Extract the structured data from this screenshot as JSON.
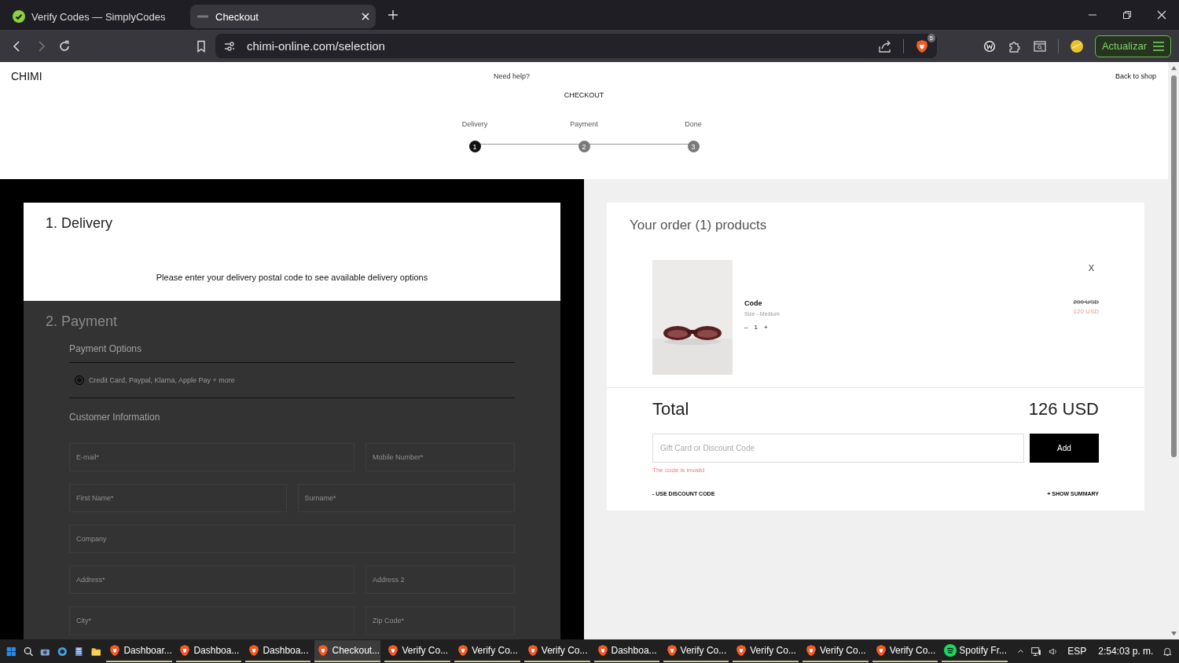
{
  "browser": {
    "tabs": [
      {
        "title": "Verify Codes — SimplyCodes",
        "selected": false
      },
      {
        "title": "Checkout",
        "selected": true
      }
    ],
    "url": "chimi-online.com/selection",
    "shield_badge": "5",
    "update_button": "Actualizar"
  },
  "header": {
    "logo": "CHIMI",
    "help": "Need help?",
    "title": "CHECKOUT",
    "back": "Back to shop"
  },
  "steps": [
    {
      "label": "Delivery",
      "number": "1",
      "selected": true
    },
    {
      "label": "Payment",
      "number": "2",
      "selected": false
    },
    {
      "label": "Done",
      "number": "3",
      "selected": false
    }
  ],
  "delivery": {
    "title": "1. Delivery",
    "message": "Please enter your delivery postal code to see available delivery options"
  },
  "payment": {
    "title": "2. Payment",
    "options_title": "Payment Options",
    "option": {
      "label": "Credit Card, Paypal, Klarna, Apple Pay + more",
      "checked": true
    },
    "customer_title": "Customer Information",
    "rows": [
      {
        "kind": "wide-narrow",
        "fields": [
          {
            "placeholder": "E-mail*"
          },
          {
            "placeholder": "Mobile Number*"
          }
        ]
      },
      {
        "kind": "even",
        "fields": [
          {
            "placeholder": "First Name*"
          },
          {
            "placeholder": "Surname*"
          }
        ]
      },
      {
        "kind": "single",
        "fields": [
          {
            "placeholder": "Company"
          }
        ]
      },
      {
        "kind": "wide-narrow",
        "fields": [
          {
            "placeholder": "Address*"
          },
          {
            "placeholder": "Address 2"
          }
        ]
      },
      {
        "kind": "wide-narrow",
        "fields": [
          {
            "placeholder": "City*"
          },
          {
            "placeholder": "Zip Code*"
          }
        ]
      }
    ]
  },
  "order": {
    "title": "Your order (1) products",
    "item": {
      "kind": "picture",
      "name": "Code",
      "size": "Size - Medium",
      "minus": "–",
      "quantity": "1",
      "plus": "+",
      "old_price": "200 USD",
      "price": "120 USD",
      "remove": "X"
    },
    "total_label": "Total",
    "total": "126 USD",
    "discount_placeholder": "Gift Card or Discount Code",
    "add": "Add",
    "error": "The code is invalid",
    "use_discount": "- USE DISCOUNT CODE",
    "show_summary": "+ SHOW SUMMARY"
  },
  "taskbar": {
    "apps": [
      {
        "label": "Dashboar...",
        "selected": false
      },
      {
        "label": "Dashboa...",
        "selected": false
      },
      {
        "label": "Dashboa...",
        "selected": false
      },
      {
        "label": "Checkout...",
        "selected": true
      },
      {
        "label": "Verify Co...",
        "selected": false
      },
      {
        "label": "Verify Co...",
        "selected": false
      },
      {
        "label": "Verify Co...",
        "selected": false
      },
      {
        "label": "Dashboa...",
        "selected": false
      },
      {
        "label": "Verify Co...",
        "selected": false
      },
      {
        "label": "Verify Co...",
        "selected": false
      },
      {
        "label": "Verify Co...",
        "selected": false
      },
      {
        "label": "Verify Co...",
        "selected": false
      },
      {
        "label": "Spotify Fr...",
        "selected": false,
        "kind": "spotify"
      }
    ],
    "language": "ESP",
    "time": "2:54:03 p. m."
  }
}
